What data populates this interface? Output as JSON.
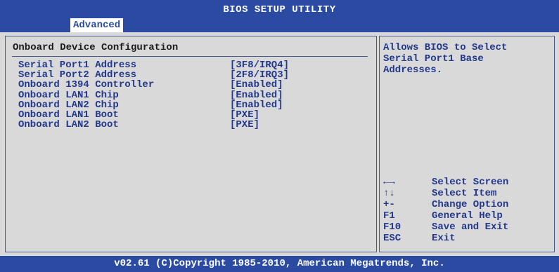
{
  "header": {
    "title": "BIOS SETUP UTILITY",
    "active_tab": "Advanced"
  },
  "main": {
    "section_title": "Onboard Device Configuration",
    "items": [
      {
        "label": "Serial Port1 Address",
        "value": "[3F8/IRQ4]"
      },
      {
        "label": "Serial Port2 Address",
        "value": "[2F8/IRQ3]"
      },
      {
        "label": "Onboard 1394 Controller",
        "value": "[Enabled]"
      },
      {
        "label": "Onboard LAN1 Chip",
        "value": "[Enabled]"
      },
      {
        "label": "Onboard LAN2 Chip",
        "value": "[Enabled]"
      },
      {
        "label": "Onboard LAN1 Boot",
        "value": "[PXE]"
      },
      {
        "label": "Onboard LAN2 Boot",
        "value": "[PXE]"
      }
    ]
  },
  "help": {
    "text": "Allows BIOS to Select Serial Port1 Base Addresses."
  },
  "keys": [
    {
      "key": "←→",
      "desc": "Select Screen"
    },
    {
      "key": "↑↓",
      "desc": "Select Item"
    },
    {
      "key": "+-",
      "desc": "Change Option"
    },
    {
      "key": "F1",
      "desc": "General Help"
    },
    {
      "key": "F10",
      "desc": "Save and Exit"
    },
    {
      "key": "ESC",
      "desc": "Exit"
    }
  ],
  "footer": {
    "copyright": "v02.61 (C)Copyright 1985-2010, American Megatrends, Inc."
  },
  "colors": {
    "bar_blue": "#2b4ba3",
    "panel_gray": "#d9d9d9",
    "text_blue": "#22388c"
  }
}
